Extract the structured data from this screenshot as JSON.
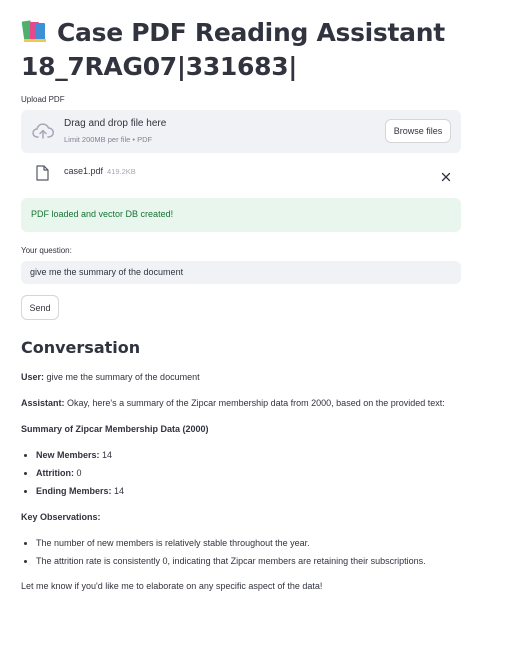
{
  "header": {
    "title_line1": "Case PDF Reading Assistant",
    "title_line2": "18_7RAG07|331683|",
    "title_icon": "books-icon"
  },
  "uploader": {
    "label": "Upload PDF",
    "dropzone_text": "Drag and drop file here",
    "limit_text": "Limit 200MB per file • PDF",
    "browse_label": "Browse files",
    "file": {
      "name": "case1.pdf",
      "size": "419.2KB"
    }
  },
  "status": {
    "success_message": "PDF loaded and vector DB created!",
    "success_color": "#177233"
  },
  "question": {
    "label": "Your question:",
    "value": "give me the summary of the document",
    "send_label": "Send"
  },
  "conversation": {
    "heading": "Conversation",
    "user_prefix": "User:",
    "user_text": " give me the summary of the document",
    "assistant_prefix": "Assistant:",
    "assistant_text": " Okay, here's a summary of the Zipcar membership data from 2000, based on the provided text:",
    "summary_heading": "Summary of Zipcar Membership Data (2000)",
    "metrics": [
      {
        "label": "New Members:",
        "value": " 14"
      },
      {
        "label": "Attrition:",
        "value": " 0"
      },
      {
        "label": "Ending Members:",
        "value": " 14"
      }
    ],
    "observations_heading": "Key Observations:",
    "observations": [
      "The number of new members is relatively stable throughout the year.",
      "The attrition rate is consistently 0, indicating that Zipcar members are retaining their subscriptions."
    ],
    "closing": "Let me know if you'd like me to elaborate on any specific aspect of the data!"
  }
}
